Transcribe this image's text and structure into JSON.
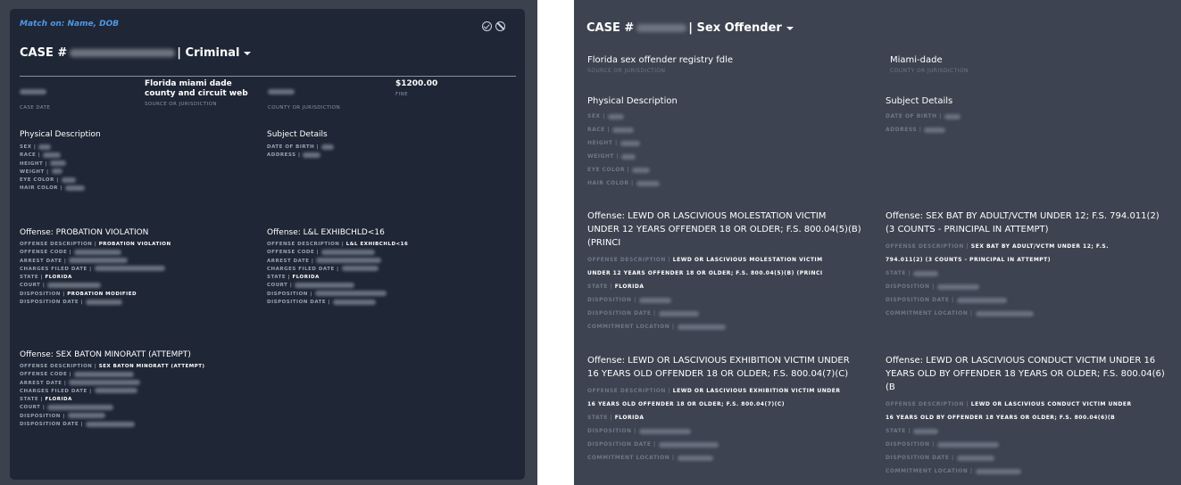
{
  "left": {
    "match_text": "Match on: Name, DOB",
    "case_prefix": "CASE #",
    "case_suffix": "| Criminal",
    "summary": {
      "col1_label": "CASE DATE",
      "col2_value": "Florida miami dade county and circuit web",
      "col2_label": "SOURCE OR JURISDICTION",
      "col3_label": "COUNTY OR JURISDICTION",
      "col4_value": "$1200.00",
      "col4_label": "FINE"
    },
    "physical_title": "Physical Description",
    "physical_rows": [
      "SEX |",
      "RACE |",
      "HEIGHT |",
      "WEIGHT |",
      "EYE COLOR |",
      "HAIR COLOR |"
    ],
    "subject_title": "Subject Details",
    "subject_rows": [
      "DATE OF BIRTH |",
      "ADDRESS |"
    ],
    "offenses": [
      {
        "title": "Offense: PROBATION VIOLATION",
        "rows": [
          {
            "label": "OFFENSE DESCRIPTION |",
            "value": "PROBATION VIOLATION"
          },
          {
            "label": "OFFENSE CODE |",
            "value": ""
          },
          {
            "label": "ARREST DATE |",
            "value": ""
          },
          {
            "label": "CHARGES FILED DATE |",
            "value": ""
          },
          {
            "label": "STATE |",
            "value": "FLORIDA"
          },
          {
            "label": "COURT |",
            "value": ""
          },
          {
            "label": "DISPOSITION |",
            "value": "PROBATION MODIFIED"
          },
          {
            "label": "DISPOSITION DATE |",
            "value": ""
          }
        ]
      },
      {
        "title": "Offense: L&L EXHIBCHLD<16",
        "rows": [
          {
            "label": "OFFENSE DESCRIPTION |",
            "value": "L&L EXHIBCHLD<16"
          },
          {
            "label": "OFFENSE CODE |",
            "value": ""
          },
          {
            "label": "ARREST DATE |",
            "value": ""
          },
          {
            "label": "CHARGES FILED DATE |",
            "value": ""
          },
          {
            "label": "STATE |",
            "value": "FLORIDA"
          },
          {
            "label": "COURT |",
            "value": ""
          },
          {
            "label": "DISPOSITION |",
            "value": ""
          },
          {
            "label": "DISPOSITION DATE |",
            "value": ""
          }
        ]
      },
      {
        "title": "Offense: SEX BATON MINORATT (ATTEMPT)",
        "rows": [
          {
            "label": "OFFENSE DESCRIPTION |",
            "value": "SEX BATON MINORATT (ATTEMPT)"
          },
          {
            "label": "OFFENSE CODE |",
            "value": ""
          },
          {
            "label": "ARREST DATE |",
            "value": ""
          },
          {
            "label": "CHARGES FILED DATE |",
            "value": ""
          },
          {
            "label": "STATE |",
            "value": "FLORIDA"
          },
          {
            "label": "COURT |",
            "value": ""
          },
          {
            "label": "DISPOSITION |",
            "value": ""
          },
          {
            "label": "DISPOSITION DATE |",
            "value": ""
          }
        ]
      }
    ]
  },
  "right": {
    "case_prefix": "CASE #",
    "case_suffix": "| Sex Offender",
    "source_value": "Florida sex offender registry fdle",
    "source_label": "SOURCE OR JURISDICTION",
    "county_value": "Miami-dade",
    "county_label": "COUNTY OR JURISDICTION",
    "physical_title": "Physical Description",
    "physical_rows": [
      "SEX |",
      "RACE |",
      "HEIGHT |",
      "WEIGHT |",
      "EYE COLOR |",
      "HAIR COLOR |"
    ],
    "subject_title": "Subject Details",
    "subject_rows": [
      "DATE OF BIRTH |",
      "ADDRESS |"
    ],
    "offenses": [
      {
        "title_lines": [
          "Offense: LEWD OR LASCIVIOUS MOLESTATION VICTIM",
          "UNDER 12 YEARS OFFENDER 18 OR OLDER; F.S. 800.04(5)(B)",
          "(PRINCI"
        ],
        "desc_label": "OFFENSE DESCRIPTION |",
        "desc_lines": [
          "LEWD OR LASCIVIOUS MOLESTATION VICTIM",
          "UNDER 12 YEARS OFFENDER 18 OR OLDER; F.S. 800.04(5)(B) (PRINCI"
        ],
        "state_label": "STATE |",
        "state_value": "FLORIDA",
        "rows": [
          "DISPOSITION |",
          "DISPOSITION DATE |",
          "COMMITMENT LOCATION |"
        ]
      },
      {
        "title_lines": [
          "Offense: SEX BAT BY ADULT/VCTM UNDER 12; F.S. 794.011(2)",
          "(3 COUNTS - PRINCIPAL IN ATTEMPT)"
        ],
        "desc_label": "OFFENSE DESCRIPTION |",
        "desc_lines": [
          "SEX BAT BY ADULT/VCTM UNDER 12; F.S.",
          "794.011(2) (3 COUNTS - PRINCIPAL IN ATTEMPT)"
        ],
        "state_label": "STATE |",
        "state_value": "",
        "rows": [
          "DISPOSITION |",
          "DISPOSITION DATE |",
          "COMMITMENT LOCATION |"
        ]
      },
      {
        "title_lines": [
          "Offense: LEWD OR LASCIVIOUS EXHIBITION VICTIM UNDER",
          "16 YEARS OLD OFFENDER 18 OR OLDER; F.S. 800.04(7)(C)"
        ],
        "desc_label": "OFFENSE DESCRIPTION |",
        "desc_lines": [
          "LEWD OR LASCIVIOUS EXHIBITION VICTIM UNDER",
          "16 YEARS OLD OFFENDER 18 OR OLDER; F.S. 800.04(7)(C)"
        ],
        "state_label": "STATE |",
        "state_value": "FLORIDA",
        "rows": [
          "DISPOSITION |",
          "DISPOSITION DATE |",
          "COMMITMENT LOCATION |"
        ]
      },
      {
        "title_lines": [
          "Offense: LEWD OR LASCIVIOUS CONDUCT VICTIM UNDER 16",
          "YEARS OLD BY OFFENDER 18 YEARS OR OLDER; F.S. 800.04(6)",
          "(B"
        ],
        "desc_label": "OFFENSE DESCRIPTION |",
        "desc_lines": [
          "LEWD OR LASCIVIOUS CONDUCT VICTIM UNDER",
          "16 YEARS OLD BY OFFENDER 18 YEARS OR OLDER; F.S. 800.04(6)(B"
        ],
        "state_label": "STATE |",
        "state_value": "",
        "rows": [
          "DISPOSITION |",
          "DISPOSITION DATE |",
          "COMMITMENT LOCATION |"
        ]
      }
    ]
  }
}
